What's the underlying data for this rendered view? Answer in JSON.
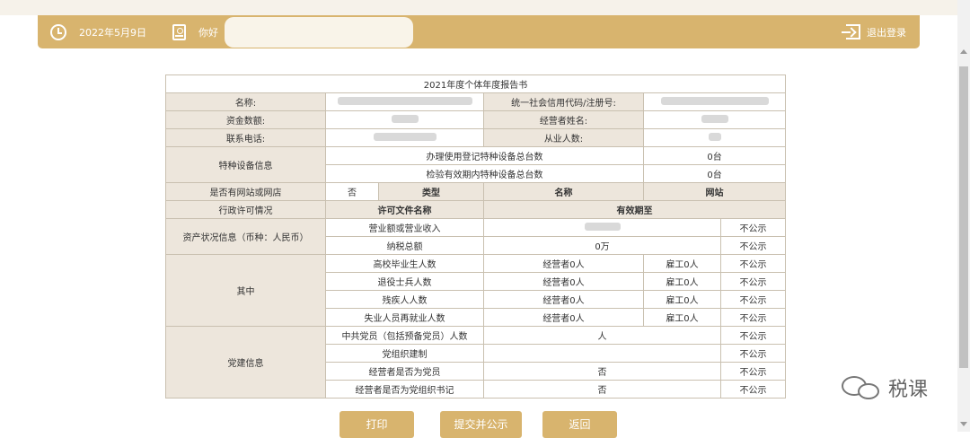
{
  "header": {
    "date": "2022年5月9日",
    "greeting": "你好",
    "logout_label": "退出登录",
    "user_name": ""
  },
  "report": {
    "title": "2021年度个体年度报告书",
    "name_label": "名称:",
    "credit_code_label": "统一社会信用代码/注册号:",
    "capital_label": "资金数额:",
    "operator_name_label": "经营者姓名:",
    "phone_label": "联系电话:",
    "employees_label": "从业人数:",
    "special_equipment_label": "特种设备信息",
    "registered_equipment_label": "办理使用登记特种设备总台数",
    "registered_equipment_value": "0台",
    "valid_inspection_label": "检验有效期内特种设备总台数",
    "valid_inspection_value": "0台",
    "website_label": "是否有网站或网店",
    "website_value": "否",
    "col_type": "类型",
    "col_name": "名称",
    "col_site": "网站",
    "license_label": "行政许可情况",
    "col_license_file": "许可文件名称",
    "col_valid_until": "有效期至",
    "assets_label": "资产状况信息（币种：人民币）",
    "revenue_label": "营业额或营业收入",
    "tax_label": "纳税总额",
    "tax_value": "0万",
    "not_public": "不公示",
    "among_label": "其中",
    "rows_among": [
      {
        "label": "高校毕业生人数",
        "operator": "经营者0人",
        "employee": "雇工0人"
      },
      {
        "label": "退役士兵人数",
        "operator": "经营者0人",
        "employee": "雇工0人"
      },
      {
        "label": "残疾人人数",
        "operator": "经营者0人",
        "employee": "雇工0人"
      },
      {
        "label": "失业人员再就业人数",
        "operator": "经营者0人",
        "employee": "雇工0人"
      }
    ],
    "party_label": "党建信息",
    "party_members_label": "中共党员（包括预备党员）人数",
    "party_members_value": "人",
    "party_org_label": "党组织建制",
    "operator_party_label": "经营者是否为党员",
    "operator_party_value": "否",
    "operator_secretary_label": "经营者是否为党组织书记",
    "operator_secretary_value": "否"
  },
  "buttons": {
    "print": "打印",
    "submit": "提交并公示",
    "back": "返回"
  },
  "watermark": {
    "text": "税课"
  },
  "colors": {
    "gold": "#d8b46e",
    "label_bg": "#ede6dc",
    "header_text": "#8a5a17"
  }
}
